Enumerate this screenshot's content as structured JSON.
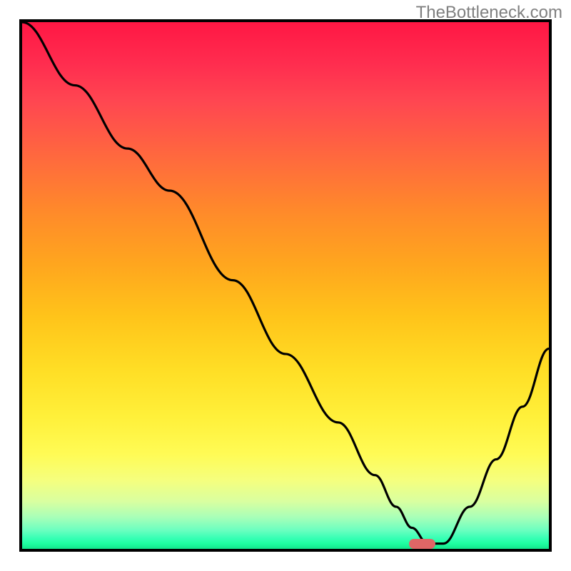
{
  "watermark": "TheBottleneck.com",
  "chart_data": {
    "type": "line",
    "title": "",
    "xlabel": "",
    "ylabel": "",
    "xlim": [
      0,
      100
    ],
    "ylim": [
      0,
      100
    ],
    "curve": {
      "x": [
        0,
        10,
        20,
        28,
        40,
        50,
        60,
        67,
        71,
        74,
        77,
        80,
        85,
        90,
        95,
        100
      ],
      "y": [
        100,
        88,
        76,
        68,
        51,
        37,
        24,
        14,
        8,
        4,
        1,
        1,
        8,
        17,
        27,
        38
      ]
    },
    "marker": {
      "x_start": 73.5,
      "x_end": 78.5,
      "y": 0.9,
      "color": "#e06666"
    },
    "gradient_stops": [
      {
        "pos": 0,
        "color": "#ff1744"
      },
      {
        "pos": 50,
        "color": "#ffc41a"
      },
      {
        "pos": 82,
        "color": "#fffb55"
      },
      {
        "pos": 99,
        "color": "#1effa0"
      },
      {
        "pos": 100,
        "color": "#14e58c"
      }
    ]
  }
}
